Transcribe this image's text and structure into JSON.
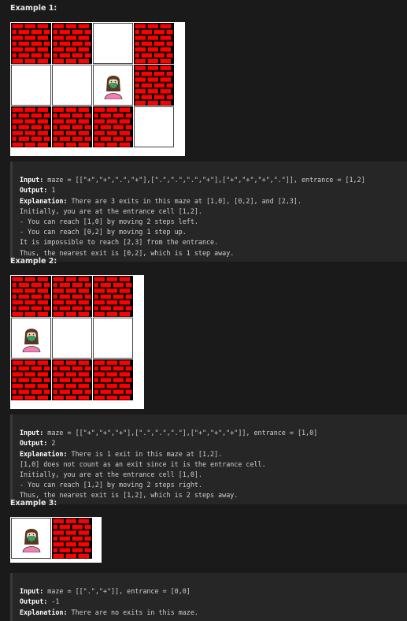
{
  "examples": [
    {
      "heading": "Example 1:",
      "maze": [
        [
          "+",
          "+",
          ".",
          "+"
        ],
        [
          ".",
          ".",
          ".",
          "+"
        ],
        [
          "+",
          "+",
          "+",
          "."
        ]
      ],
      "entrance": [
        1,
        2
      ],
      "input_label": "Input:",
      "input_text": " maze = [[\"+\",\"+\",\".\",\"+\"],[\".\",\".\",\".\",\"+\"],[\"+\",\"+\",\"+\",\".\"]], entrance = [1,2]",
      "output_label": "Output:",
      "output_text": " 1",
      "explanation_label": "Explanation:",
      "explanation_text": " There are 3 exits in this maze at [1,0], [0,2], and [2,3].",
      "explanation_lines": [
        "Initially, you are at the entrance cell [1,2].",
        "- You can reach [1,0] by moving 2 steps left.",
        "- You can reach [0,2] by moving 1 step up.",
        "It is impossible to reach [2,3] from the entrance.",
        "Thus, the nearest exit is [0,2], which is 1 step away."
      ]
    },
    {
      "heading": "Example 2:",
      "maze": [
        [
          "+",
          "+",
          "+"
        ],
        [
          ".",
          ".",
          "."
        ],
        [
          "+",
          "+",
          "+"
        ]
      ],
      "entrance": [
        1,
        0
      ],
      "input_label": "Input:",
      "input_text": " maze = [[\"+\",\"+\",\"+\"],[\".\",\".\",\".\"],[\"+\",\"+\",\"+\"]], entrance = [1,0]",
      "output_label": "Output:",
      "output_text": " 2",
      "explanation_label": "Explanation:",
      "explanation_text": " There is 1 exit in this maze at [1,2].",
      "explanation_lines": [
        "[1,0] does not count as an exit since it is the entrance cell.",
        "Initially, you are at the entrance cell [1,0].",
        "- You can reach [1,2] by moving 2 steps right.",
        "Thus, the nearest exit is [1,2], which is 2 steps away."
      ]
    },
    {
      "heading": "Example 3:",
      "maze": [
        [
          ".",
          "+"
        ]
      ],
      "entrance": [
        0,
        0
      ],
      "input_label": "Input:",
      "input_text": " maze = [[\".\",\"+\"]], entrance = [0,0]",
      "output_label": "Output:",
      "output_text": " -1",
      "explanation_label": "Explanation:",
      "explanation_text": " There are no exits in this maze.",
      "explanation_lines": []
    }
  ],
  "icons": {
    "wall": "brick-wall-icon",
    "entrance": "person-icon"
  },
  "colors": {
    "brick": "#ff0000",
    "mortar": "#000000",
    "background": "#1a1a1a"
  }
}
